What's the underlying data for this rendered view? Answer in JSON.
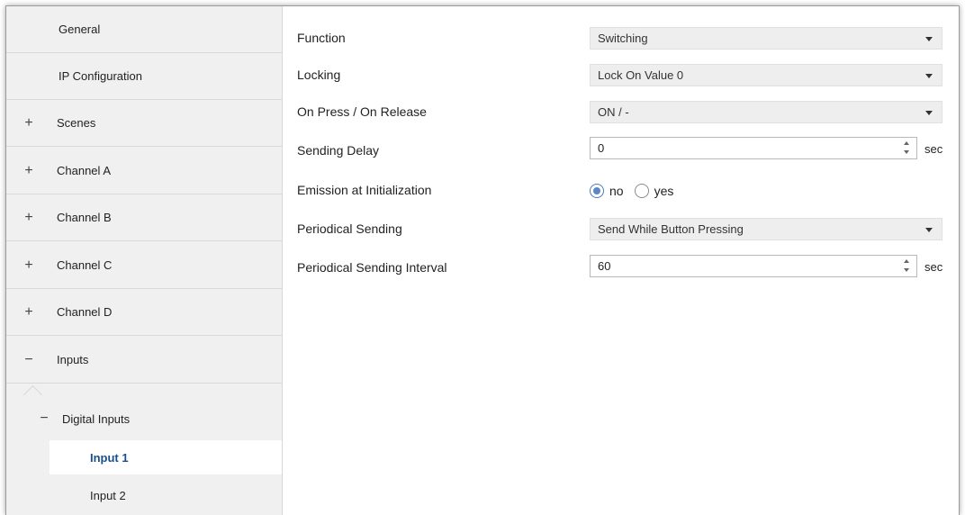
{
  "sidebar": {
    "items": [
      {
        "sign": "",
        "label": "General"
      },
      {
        "sign": "",
        "label": "IP Configuration"
      },
      {
        "sign": "+",
        "label": "Scenes"
      },
      {
        "sign": "+",
        "label": "Channel A"
      },
      {
        "sign": "+",
        "label": "Channel B"
      },
      {
        "sign": "+",
        "label": "Channel C"
      },
      {
        "sign": "+",
        "label": "Channel D"
      },
      {
        "sign": "−",
        "label": "Inputs"
      }
    ],
    "digital_inputs": {
      "sign": "−",
      "label": "Digital Inputs"
    },
    "input1": "Input 1",
    "input2": "Input 2"
  },
  "params": {
    "function": {
      "label": "Function",
      "value": "Switching"
    },
    "locking": {
      "label": "Locking",
      "value": "Lock On Value 0"
    },
    "press_release": {
      "label": "On Press / On Release",
      "value": "ON / -"
    },
    "sending_delay": {
      "label": "Sending Delay",
      "value": "0",
      "unit": "sec"
    },
    "emission": {
      "label": "Emission at Initialization",
      "option_no": "no",
      "option_yes": "yes",
      "selected": "no"
    },
    "periodical": {
      "label": "Periodical Sending",
      "value": "Send While Button Pressing"
    },
    "interval": {
      "label": "Periodical Sending Interval",
      "value": "60",
      "unit": "sec"
    }
  },
  "colors": {
    "selected_text": "#1a4f8c",
    "sidebar_bg": "#f0f0f0",
    "radio_accent": "#5b87c9"
  }
}
